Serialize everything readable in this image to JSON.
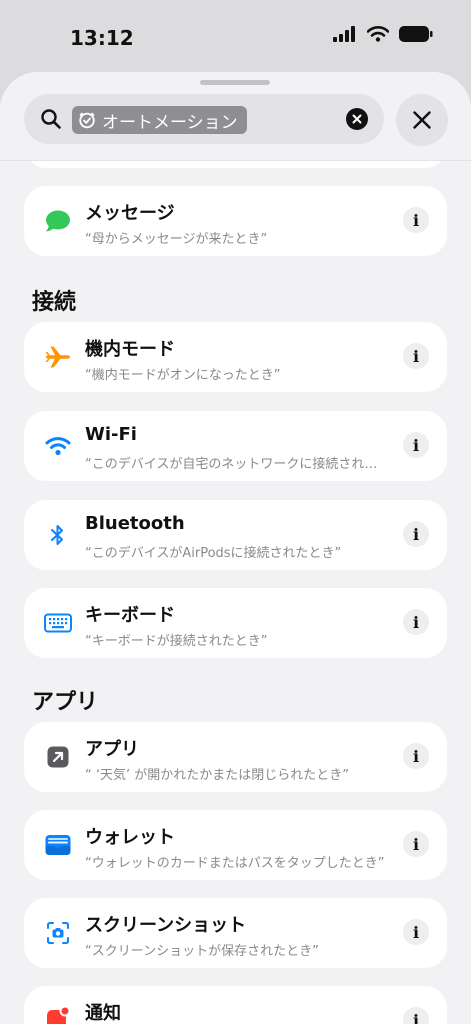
{
  "status_bar": {
    "time": "13:12"
  },
  "search": {
    "token_label": "オートメーション",
    "icons": {
      "search": "magnifier-icon",
      "token": "clock-check-icon",
      "clear": "clear-x-icon",
      "close": "close-x-icon"
    }
  },
  "top_partial_card": {},
  "items": {
    "message": {
      "title": "メッセージ",
      "subtitle": "“母からメッセージが来たとき”",
      "icon": "message-bubble-icon",
      "color": "#34c759"
    },
    "airplane": {
      "title": "機内モード",
      "subtitle": "“機内モードがオンになったとき”",
      "icon": "airplane-icon",
      "color": "#ff9500"
    },
    "wifi": {
      "title": "Wi-Fi",
      "subtitle": "“このデバイスが自宅のネットワークに接続されたとき”",
      "icon": "wifi-icon",
      "color": "#0a84ff"
    },
    "bluetooth": {
      "title": "Bluetooth",
      "subtitle": "“このデバイスがAirPodsに接続されたとき”",
      "icon": "bluetooth-icon",
      "color": "#0a84ff"
    },
    "keyboard": {
      "title": "キーボード",
      "subtitle": "“キーボードが接続されたとき”",
      "icon": "keyboard-icon",
      "color": "#0a84ff"
    },
    "app": {
      "title": "アプリ",
      "subtitle": "“ ‘天気’ が開かれたかまたは閉じられたとき”",
      "icon": "app-arrow-icon",
      "color": "#5a5a5e"
    },
    "wallet": {
      "title": "ウォレット",
      "subtitle": "“ウォレットのカードまたはパスをタップしたとき”",
      "icon": "wallet-icon",
      "color": "#0a84ff"
    },
    "screenshot": {
      "title": "スクリーンショット",
      "subtitle": "“スクリーンショットが保存されたとき”",
      "icon": "screenshot-icon",
      "color": "#0a84ff"
    },
    "notification": {
      "title": "通知",
      "icon": "notification-icon",
      "color": "#ff3b30"
    }
  },
  "sections": {
    "connection": "接続",
    "apps": "アプリ"
  },
  "info_glyph": "i"
}
